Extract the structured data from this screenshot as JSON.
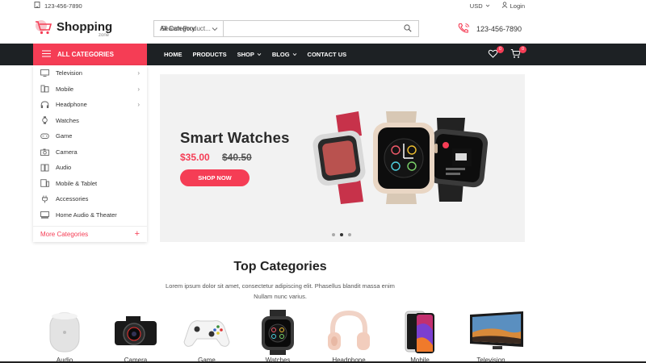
{
  "topbar": {
    "phone": "123-456-7890",
    "currency": "USD",
    "login": "Login"
  },
  "header": {
    "logo_name": "Shopping",
    "logo_sub": "zone",
    "category_select": "All Category",
    "search_placeholder": "Search Product...",
    "phone": "123-456-7890"
  },
  "nav": {
    "all_categories": "ALL CATEGORIES",
    "items": [
      "HOME",
      "PRODUCTS",
      "SHOP",
      "BLOG",
      "CONTACT US"
    ],
    "wishlist_count": "0",
    "cart_count": "0"
  },
  "sidebar": {
    "items": [
      {
        "label": "Television",
        "icon": "tv-icon"
      },
      {
        "label": "Mobile",
        "icon": "mobile-icon"
      },
      {
        "label": "Headphone",
        "icon": "headphone-icon"
      },
      {
        "label": "Watches",
        "icon": "watch-icon"
      },
      {
        "label": "Game",
        "icon": "gamepad-icon"
      },
      {
        "label": "Camera",
        "icon": "camera-icon"
      },
      {
        "label": "Audio",
        "icon": "speaker-icon"
      },
      {
        "label": "Mobile & Tablet",
        "icon": "tablet-icon"
      },
      {
        "label": "Accessories",
        "icon": "plug-icon"
      },
      {
        "label": "Home Audio & Theater",
        "icon": "theater-icon"
      }
    ],
    "more": "More Categories"
  },
  "hero": {
    "title": "Smart Watches",
    "price": "$35.00",
    "old_price": "$40.50",
    "button": "SHOP NOW"
  },
  "top_categories": {
    "title": "Top Categories",
    "description": "Lorem ipsum dolor sit amet, consectetur adipiscing elit. Phasellus blandit massa enim Nullam nunc varius.",
    "items": [
      "Audio",
      "Camera",
      "Game",
      "Watches",
      "Headphone",
      "Mobile",
      "Television"
    ]
  },
  "colors": {
    "accent": "#f53d55",
    "nav_bg": "#1d2124"
  }
}
